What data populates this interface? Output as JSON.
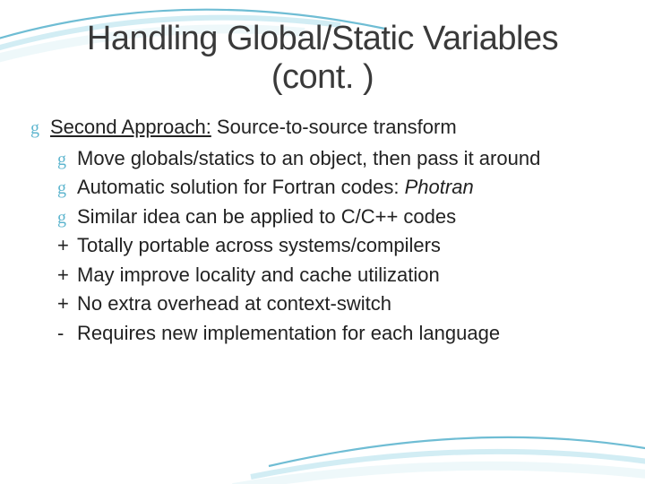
{
  "slide": {
    "title_line1": "Handling Global/Static Variables",
    "title_line2": "(cont. )",
    "main": {
      "label_under": "Second Approach:",
      "label_rest": " Source-to-source transform"
    },
    "subs": [
      {
        "text": "Move globals/statics to an object, then pass it around"
      },
      {
        "text_pre": "Automatic solution for Fortran codes: ",
        "text_em": "Photran"
      },
      {
        "text": "Similar idea can be applied to C/C++ codes"
      }
    ],
    "pros_cons": [
      {
        "sym": "+",
        "text": "Totally portable across systems/compilers"
      },
      {
        "sym": "+",
        "text": "May improve locality and cache utilization"
      },
      {
        "sym": "+",
        "text": "No extra overhead at context-switch"
      },
      {
        "sym": "-",
        "text": "Requires new implementation for each language"
      }
    ]
  },
  "icons": {
    "swirl": "g"
  },
  "colors": {
    "accent": "#5fb6cf",
    "text": "#3a3a3a"
  }
}
